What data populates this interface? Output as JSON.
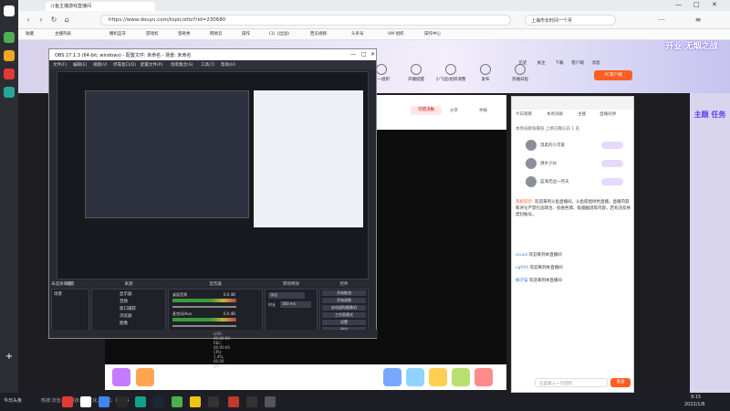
{
  "browser": {
    "tab_title": "斗鱼主播游戏直播间",
    "url": "https://www.douyu.com/topic/zttz?rid=230680",
    "search_text": "上海市长时间一个月",
    "bookmarks": [
      "收藏",
      "主播列表",
      "撒机蓝牙",
      "游戏机",
      "猎奇秀",
      "网易云",
      "操作",
      "(1)《出战》",
      "西瓜视频",
      "头条号",
      "UM 组织",
      "操作中心"
    ]
  },
  "site": {
    "nav": [
      "第一组织",
      "开播提醒",
      "小飞鼠/组织调整",
      "发布",
      "热播日程",
      "历史",
      "关注",
      "下载",
      "客户端",
      "消息"
    ],
    "pc_client": "PC客户端",
    "banner_text": "开业 无烟之战",
    "right_banner": "主题 任务",
    "room_actions": [
      "可错决数",
      "分享",
      "举报"
    ]
  },
  "chat": {
    "tabs": [
      "今日观看",
      "本周贡献",
      "主播",
      "直播间弹"
    ],
    "top_notice": "本场贡献值最低 上榜已确认前 1 名",
    "rank_users": [
      {
        "name": "温柔的小可爱"
      },
      {
        "name": "清水小伙"
      },
      {
        "name": "蓝海无边一月天"
      }
    ],
    "system_label": "系统提示:",
    "system_msg": "欢迎来到斗鱼直播间，斗鱼提倡绿色直播，直播内容和评论严禁包含政治、低俗色情、吸烟酗酒等内容，若有违反将禁封账号。",
    "messages": [
      {
        "user": "xcuoii",
        "text": "欢迎来到本直播间"
      },
      {
        "user": "cgfrtrt",
        "text": "欢迎来到本直播间"
      },
      {
        "user": "橘子猫",
        "text": "欢迎来到本直播间"
      }
    ],
    "input_placeholder": "这里输入一句话吧",
    "send_label": "发送"
  },
  "obs": {
    "title": "OBS 27.1.3 (64-bit, windows) - 配置文件: 未命名 - 场景: 未命名",
    "menu": [
      "文件(F)",
      "编辑(E)",
      "视图(V)",
      "停靠窗口(D)",
      "配置文件(P)",
      "场景集合(S)",
      "工具(T)",
      "帮助(H)"
    ],
    "docks": [
      "场景",
      "来源",
      "混音器",
      "转场特效",
      "控件"
    ],
    "scene_item": "场景",
    "sources": [
      "显示器",
      "音频",
      "窗口捕获",
      "浏览器",
      "图像"
    ],
    "mixer": [
      {
        "name": "桌面音频",
        "level": "0.0 dB"
      },
      {
        "name": "麦克风/Aux",
        "level": "0.0 dB"
      }
    ],
    "transition": {
      "type": "淡出",
      "duration_label": "时长",
      "duration": "300 ms"
    },
    "controls": [
      "开始推流",
      "开始录制",
      "启动虚拟摄像机",
      "工作室模式",
      "设置",
      "退出"
    ],
    "status": "LIVE: 00:00:00   REC: 00:00:00   CPU: 1.4%, 60.00 fps",
    "no_source_label": "未选择来源"
  },
  "taskbar": {
    "weather": "今日头条",
    "ticker": "热搜:法治、数量技术、优化、新闻、新鲜事",
    "time": "9:15",
    "date": "2022/1/8"
  }
}
